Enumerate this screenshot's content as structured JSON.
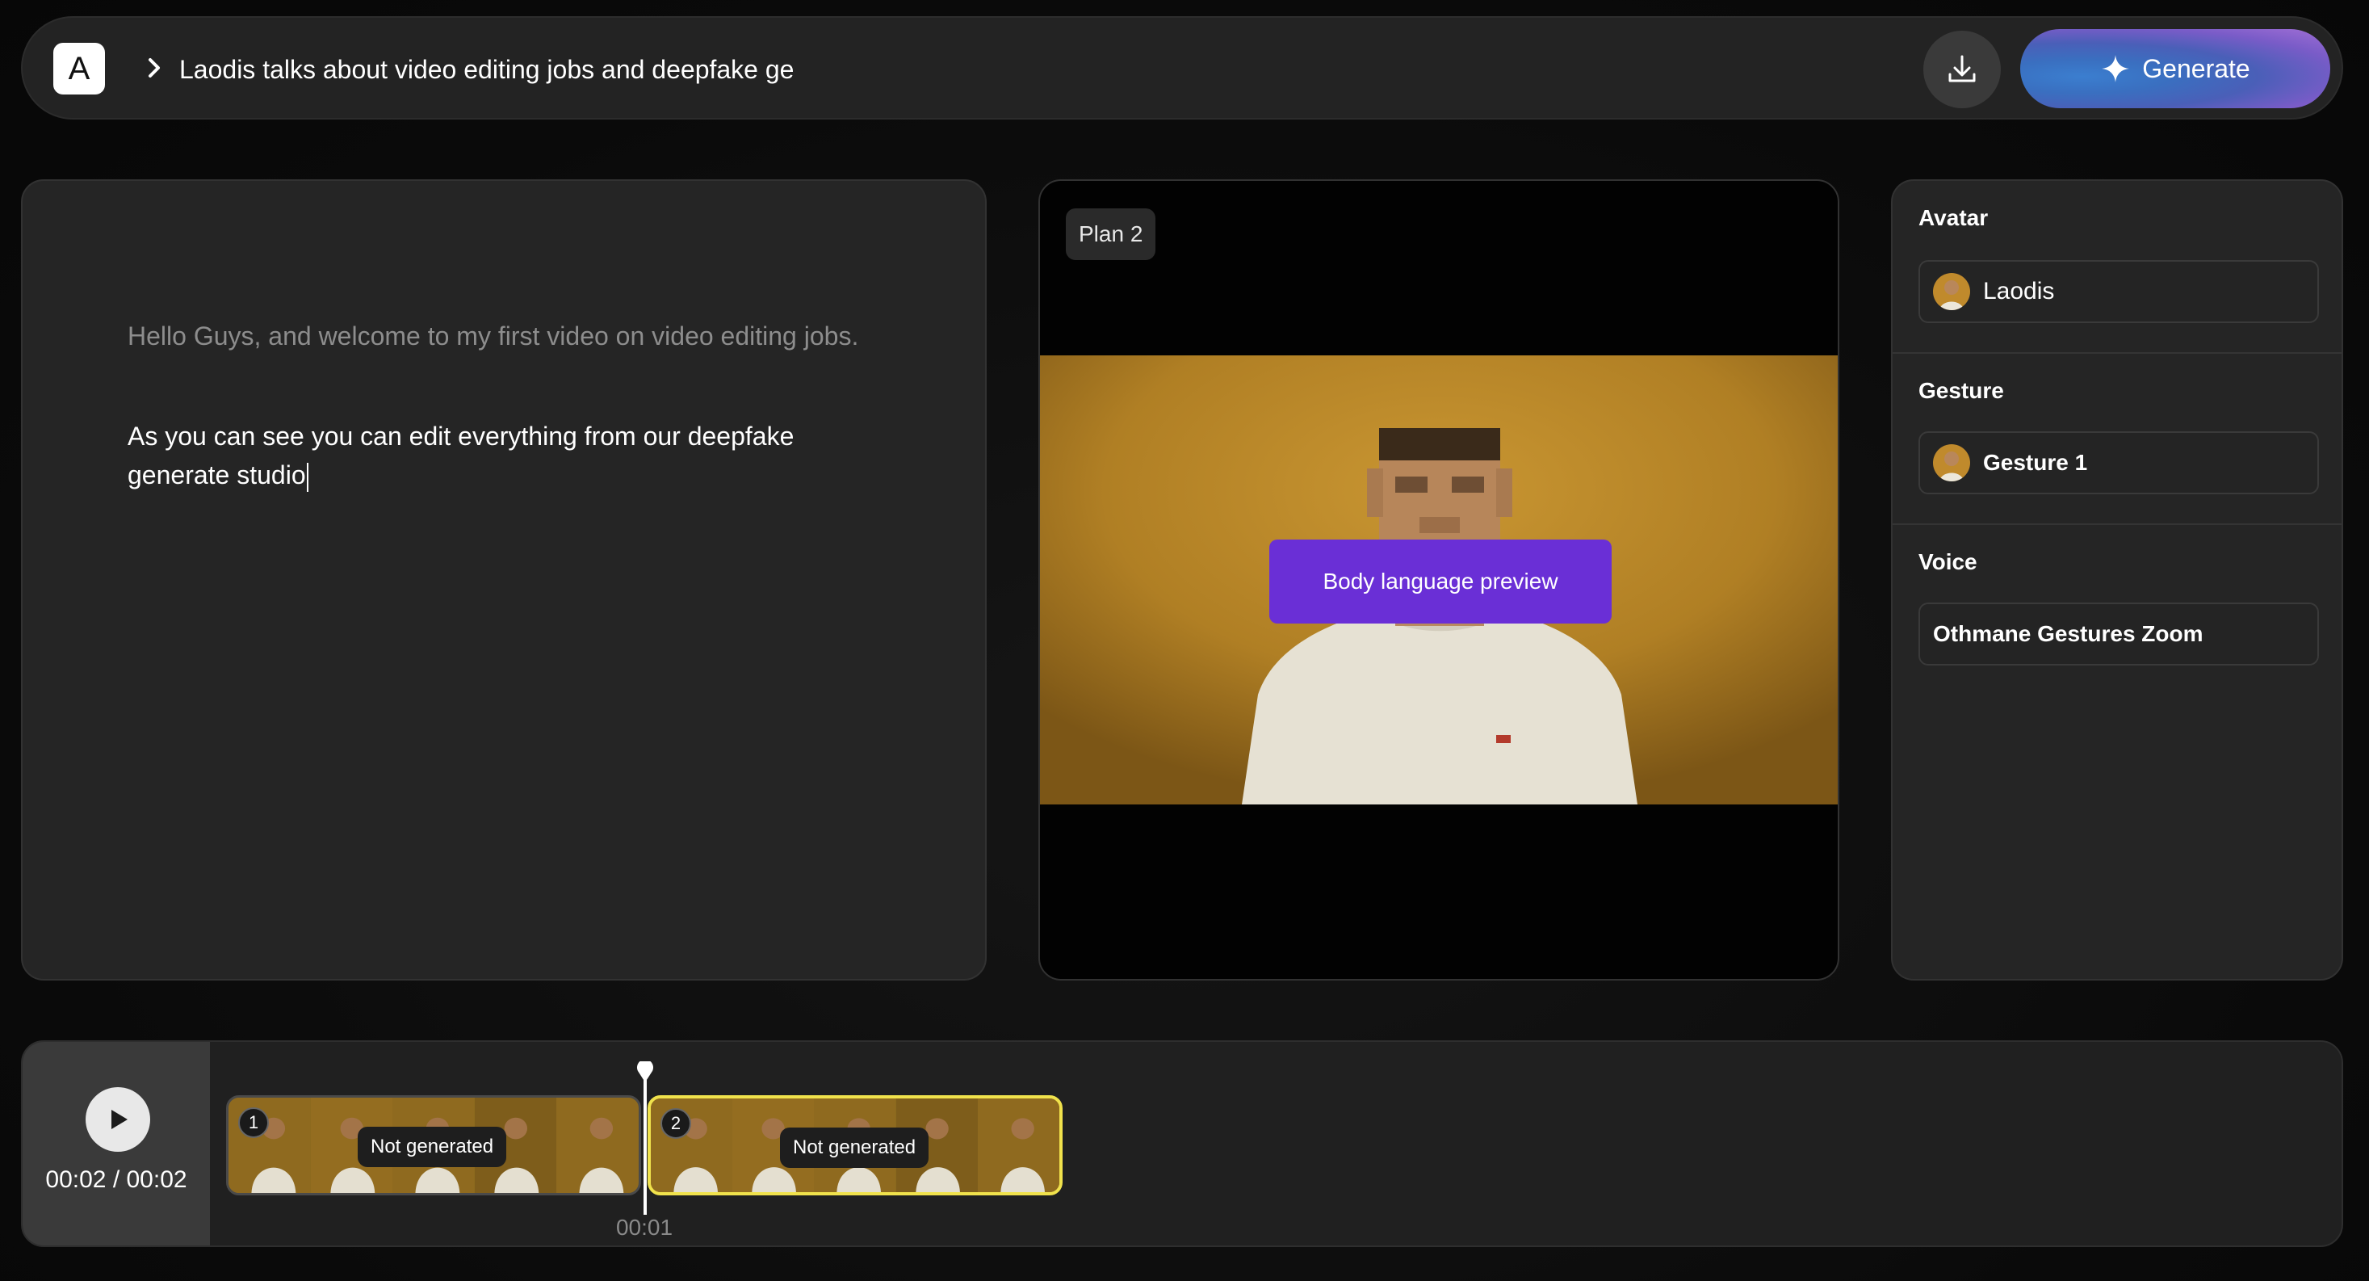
{
  "header": {
    "logo_letter": "A",
    "project_title": "Laodis talks about video editing jobs and deepfake ge",
    "download_icon": "download-icon",
    "generate_label": "Generate",
    "generate_icon": "sparkle-icon"
  },
  "script": {
    "line1": "Hello Guys, and welcome to my first video on video editing jobs.",
    "line2": "As you can see you can edit everything from our deepfake generate studio"
  },
  "preview": {
    "plan_label": "Plan 2",
    "overlay_button": "Body language preview"
  },
  "properties": {
    "avatar_label": "Avatar",
    "avatar_value": "Laodis",
    "gesture_label": "Gesture",
    "gesture_value": "Gesture 1",
    "voice_label": "Voice",
    "voice_value": "Othmane Gestures Zoom"
  },
  "timeline": {
    "play_icon": "play-icon",
    "time_display": "00:02 / 00:02",
    "playhead_time": "00:01",
    "clips": [
      {
        "number": "1",
        "status": "Not generated",
        "selected": false
      },
      {
        "number": "2",
        "status": "Not generated",
        "selected": true
      }
    ]
  },
  "colors": {
    "accent_purple": "#6a2fd6",
    "selected_clip": "#f0e24c",
    "panel_bg": "#252525"
  }
}
